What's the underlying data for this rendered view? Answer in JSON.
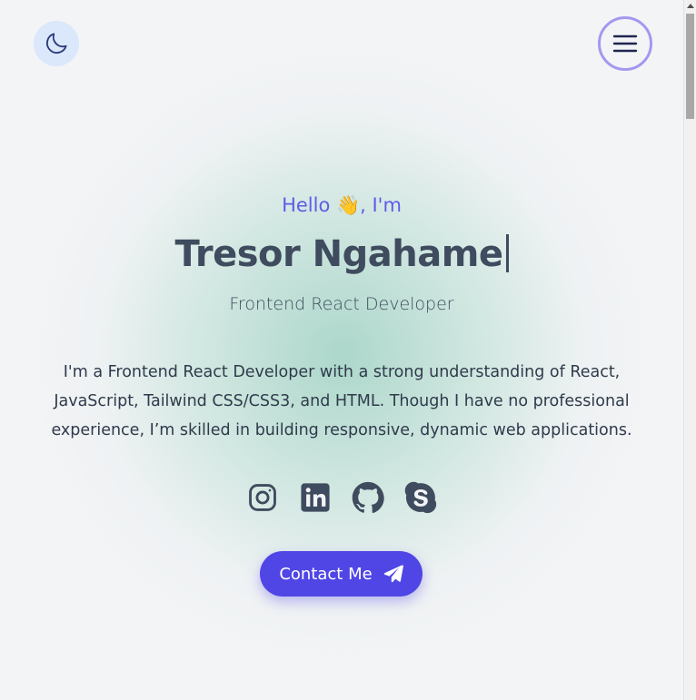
{
  "header": {
    "theme_toggle_icon": "moon-icon",
    "menu_icon": "hamburger-menu-icon"
  },
  "hero": {
    "greeting": "Hello 👋, I'm",
    "name": "Tresor Ngahame",
    "role": "Frontend React Developer",
    "bio": "I'm a Frontend React Developer with a strong understanding of React, JavaScript, Tailwind CSS/CSS3, and HTML. Though I have no professional experience, I’m skilled in building responsive, dynamic web applications.",
    "socials": [
      {
        "icon": "instagram-icon"
      },
      {
        "icon": "linkedin-icon"
      },
      {
        "icon": "github-icon"
      },
      {
        "icon": "skype-icon"
      }
    ],
    "contact_label": "Contact Me",
    "contact_icon": "paper-plane-icon"
  },
  "colors": {
    "accent": "#4f46e5",
    "greeting": "#5f5ce6",
    "text": "#3f4b5e",
    "menu_border": "#a597ef",
    "toggle_bg": "#dbe7fb"
  }
}
